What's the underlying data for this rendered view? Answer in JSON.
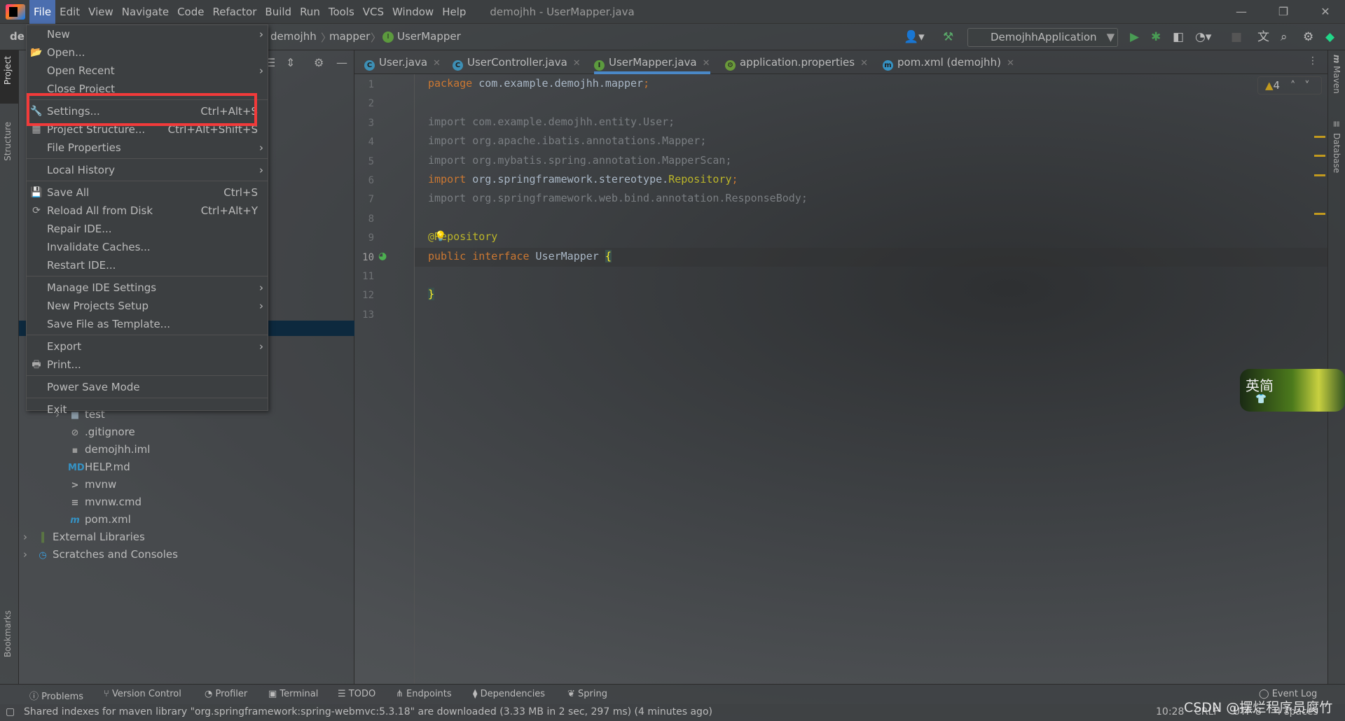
{
  "menubar": {
    "items": [
      "File",
      "Edit",
      "View",
      "Navigate",
      "Code",
      "Refactor",
      "Build",
      "Run",
      "Tools",
      "VCS",
      "Window",
      "Help"
    ],
    "active": "File",
    "window_title": "demojhh - UserMapper.java"
  },
  "navbar": {
    "project_abbrev": "de",
    "breadcrumbs": [
      "demojhh",
      "mapper",
      "UserMapper"
    ],
    "run_config": "DemojhhApplication"
  },
  "side_tools": {
    "left": [
      "Project",
      "Structure",
      "Bookmarks"
    ],
    "right": [
      "Maven",
      "Database"
    ]
  },
  "file_menu": {
    "items": [
      {
        "label": "New",
        "submenu": true
      },
      {
        "label": "Open...",
        "icon": "folder-open-icon",
        "glyph": "📂"
      },
      {
        "label": "Open Recent",
        "submenu": true
      },
      {
        "label": "Close Project",
        "sep_after": true
      },
      {
        "label": "Settings...",
        "shortcut": "Ctrl+Alt+S",
        "icon": "wrench-icon",
        "glyph": "🔧",
        "highlighted": true
      },
      {
        "label": "Project Structure...",
        "shortcut": "Ctrl+Alt+Shift+S",
        "icon": "project-structure-icon",
        "glyph": "▦"
      },
      {
        "label": "File Properties",
        "submenu": true,
        "sep_after": true
      },
      {
        "label": "Local History",
        "submenu": true,
        "sep_after": true
      },
      {
        "label": "Save All",
        "shortcut": "Ctrl+S",
        "icon": "save-icon",
        "glyph": "💾"
      },
      {
        "label": "Reload All from Disk",
        "shortcut": "Ctrl+Alt+Y",
        "icon": "reload-icon",
        "glyph": "⟳"
      },
      {
        "label": "Repair IDE..."
      },
      {
        "label": "Invalidate Caches..."
      },
      {
        "label": "Restart IDE...",
        "sep_after": true
      },
      {
        "label": "Manage IDE Settings",
        "submenu": true
      },
      {
        "label": "New Projects Setup",
        "submenu": true
      },
      {
        "label": "Save File as Template...",
        "sep_after": true
      },
      {
        "label": "Export",
        "submenu": true
      },
      {
        "label": "Print...",
        "icon": "print-icon",
        "glyph": "🖶",
        "sep_after": true
      },
      {
        "label": "Power Save Mode",
        "sep_after": true
      },
      {
        "label": "Exit"
      }
    ]
  },
  "project_tree": [
    {
      "label": "test",
      "icon": "folder-icon",
      "depth": 2,
      "expandable": true
    },
    {
      "label": ".gitignore",
      "icon": "gitignore-file-icon",
      "depth": 2
    },
    {
      "label": "demojhh.iml",
      "icon": "iml-file-icon",
      "depth": 2
    },
    {
      "label": "HELP.md",
      "icon": "markdown-file-icon",
      "depth": 2
    },
    {
      "label": "mvnw",
      "icon": "shell-script-icon",
      "depth": 2
    },
    {
      "label": "mvnw.cmd",
      "icon": "text-file-icon",
      "depth": 2
    },
    {
      "label": "pom.xml",
      "icon": "maven-icon",
      "depth": 2
    },
    {
      "label": "External Libraries",
      "icon": "libraries-icon",
      "depth": 0,
      "expandable": true
    },
    {
      "label": "Scratches and Consoles",
      "icon": "scratches-icon",
      "depth": 0,
      "expandable": true
    }
  ],
  "tabs": [
    {
      "label": "User.java",
      "icon": "class-icon",
      "letter": "C",
      "color": "#3d8fb5"
    },
    {
      "label": "UserController.java",
      "icon": "class-icon",
      "letter": "C",
      "color": "#3d8fb5"
    },
    {
      "label": "UserMapper.java",
      "icon": "interface-icon",
      "letter": "I",
      "color": "#5c9a3e",
      "active": true
    },
    {
      "label": "application.properties",
      "icon": "spring-properties-icon",
      "letter": "⚙",
      "color": "#6a9a3a"
    },
    {
      "label": "pom.xml (demojhh)",
      "icon": "maven-icon",
      "letter": "m",
      "color": "#3592c4"
    }
  ],
  "editor": {
    "current_line": 10,
    "warnings": "4",
    "lines": [
      [
        {
          "t": "package ",
          "c": "kw"
        },
        {
          "t": "com.example.demojhh.mapper",
          "c": "plain"
        },
        {
          "t": ";",
          "c": "kw"
        }
      ],
      [],
      [
        {
          "t": "import com.example.demojhh.entity.User;",
          "c": "dim"
        }
      ],
      [
        {
          "t": "import org.apache.ibatis.annotations.Mapper;",
          "c": "dim"
        }
      ],
      [
        {
          "t": "import org.mybatis.spring.annotation.MapperScan;",
          "c": "dim"
        }
      ],
      [
        {
          "t": "import ",
          "c": "kw"
        },
        {
          "t": "org.springframework.stereotype.",
          "c": "plain"
        },
        {
          "t": "Repository",
          "c": "ann"
        },
        {
          "t": ";",
          "c": "kw"
        }
      ],
      [
        {
          "t": "import org.springframework.web.bind.annotation.ResponseBody;",
          "c": "dim"
        }
      ],
      [],
      [
        {
          "t": "@Repository",
          "c": "ann"
        }
      ],
      [
        {
          "t": "public interface ",
          "c": "kw"
        },
        {
          "t": "UserMapper ",
          "c": "plain"
        },
        {
          "t": "{",
          "c": "brace"
        }
      ],
      [],
      [
        {
          "t": "}",
          "c": "brace"
        }
      ],
      []
    ]
  },
  "bottom_tools": [
    "Problems",
    "Version Control",
    "Profiler",
    "Terminal",
    "TODO",
    "Endpoints",
    "Dependencies",
    "Spring"
  ],
  "event_log": "Event Log",
  "status": {
    "message": "Shared indexes for maven library \"org.springframework:spring-webmvc:5.3.18\" are downloaded (3.33 MB in 2 sec, 297 ms) (4 minutes ago)",
    "position": "10:28",
    "line_sep": "CRLF",
    "encoding": "UTF-8",
    "indent": "4 spaces"
  },
  "watermark": "CSDN @摆烂程序员腐竹",
  "widget": {
    "label": "英简"
  },
  "colors": {
    "accent": "#4b6eaf",
    "highlight_box": "#f23a3a",
    "tab_underline": "#4a88c7"
  }
}
